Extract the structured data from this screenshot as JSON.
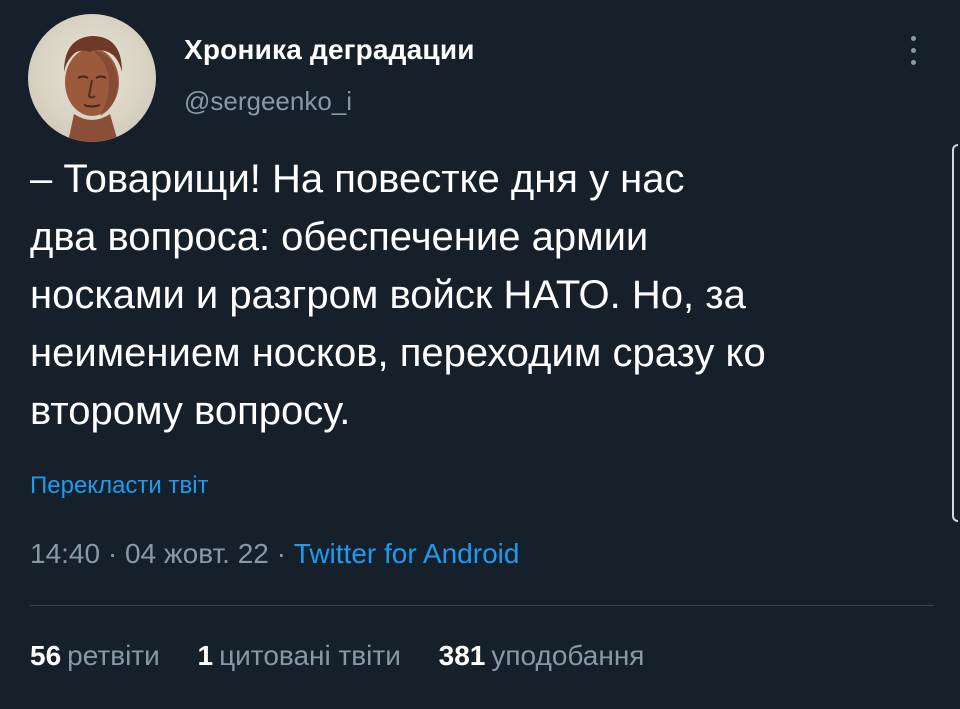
{
  "header": {
    "display_name": "Хроника деградации",
    "handle": "@sergeenko_i",
    "avatar_icon": "bust-portrait-icon",
    "more_icon": "more-vertical-icon"
  },
  "tweet": {
    "text": "– Товарищи! На повестке дня у нас\nдва вопроса: обеспечение армии\nносками и разгром войск НАТО. Но, за\nнеимением носков, переходим сразу ко\nвторому вопросу.",
    "translate_label": "Перекласти твіт"
  },
  "meta": {
    "time": "14:40",
    "separator": "·",
    "date": "04 жовт. 22",
    "source": "Twitter for Android"
  },
  "stats": {
    "retweets_count": "56",
    "retweets_label": "ретвіти",
    "quotes_count": "1",
    "quotes_label": "цитовані твіти",
    "likes_count": "381",
    "likes_label": "уподобання"
  },
  "colors": {
    "background": "#15202b",
    "text": "#ffffff",
    "secondary": "#8899a6",
    "accent": "#1d9bf0",
    "divider": "#38444d"
  }
}
